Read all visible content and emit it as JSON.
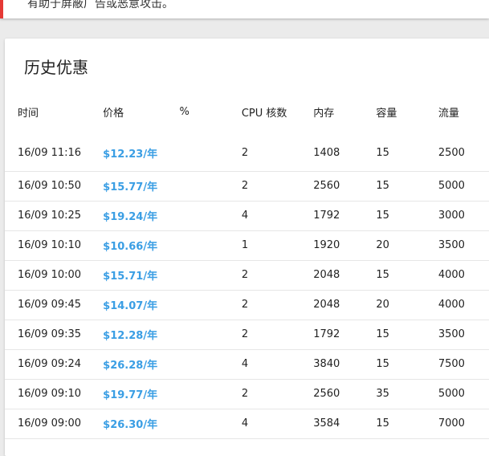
{
  "top_notice": {
    "text": "有助于屏蔽广告或恶意攻击。"
  },
  "history": {
    "title": "历史优惠",
    "columns": [
      "时间",
      "价格",
      "%",
      "CPU 核数",
      "内存",
      "容量",
      "流量"
    ],
    "rows": [
      {
        "time": "16/09 11:16",
        "price": "$12.23/年",
        "pct": "",
        "cpu": "2",
        "mem": "1408",
        "cap": "15",
        "flow": "2500"
      },
      {
        "time": "16/09 10:50",
        "price": "$15.77/年",
        "pct": "",
        "cpu": "2",
        "mem": "2560",
        "cap": "15",
        "flow": "5000"
      },
      {
        "time": "16/09 10:25",
        "price": "$19.24/年",
        "pct": "",
        "cpu": "4",
        "mem": "1792",
        "cap": "15",
        "flow": "3000"
      },
      {
        "time": "16/09 10:10",
        "price": "$10.66/年",
        "pct": "",
        "cpu": "1",
        "mem": "1920",
        "cap": "20",
        "flow": "3500"
      },
      {
        "time": "16/09 10:00",
        "price": "$15.71/年",
        "pct": "",
        "cpu": "2",
        "mem": "2048",
        "cap": "15",
        "flow": "4000"
      },
      {
        "time": "16/09 09:45",
        "price": "$14.07/年",
        "pct": "",
        "cpu": "2",
        "mem": "2048",
        "cap": "20",
        "flow": "4000"
      },
      {
        "time": "16/09 09:35",
        "price": "$12.28/年",
        "pct": "",
        "cpu": "2",
        "mem": "1792",
        "cap": "15",
        "flow": "3500"
      },
      {
        "time": "16/09 09:24",
        "price": "$26.28/年",
        "pct": "",
        "cpu": "4",
        "mem": "3840",
        "cap": "15",
        "flow": "7500"
      },
      {
        "time": "16/09 09:10",
        "price": "$19.77/年",
        "pct": "",
        "cpu": "2",
        "mem": "2560",
        "cap": "35",
        "flow": "5000"
      },
      {
        "time": "16/09 09:00",
        "price": "$26.30/年",
        "pct": "",
        "cpu": "4",
        "mem": "3584",
        "cap": "15",
        "flow": "7000"
      }
    ]
  },
  "colors": {
    "price": "#3a9ee4",
    "alert_border": "#e53935"
  }
}
